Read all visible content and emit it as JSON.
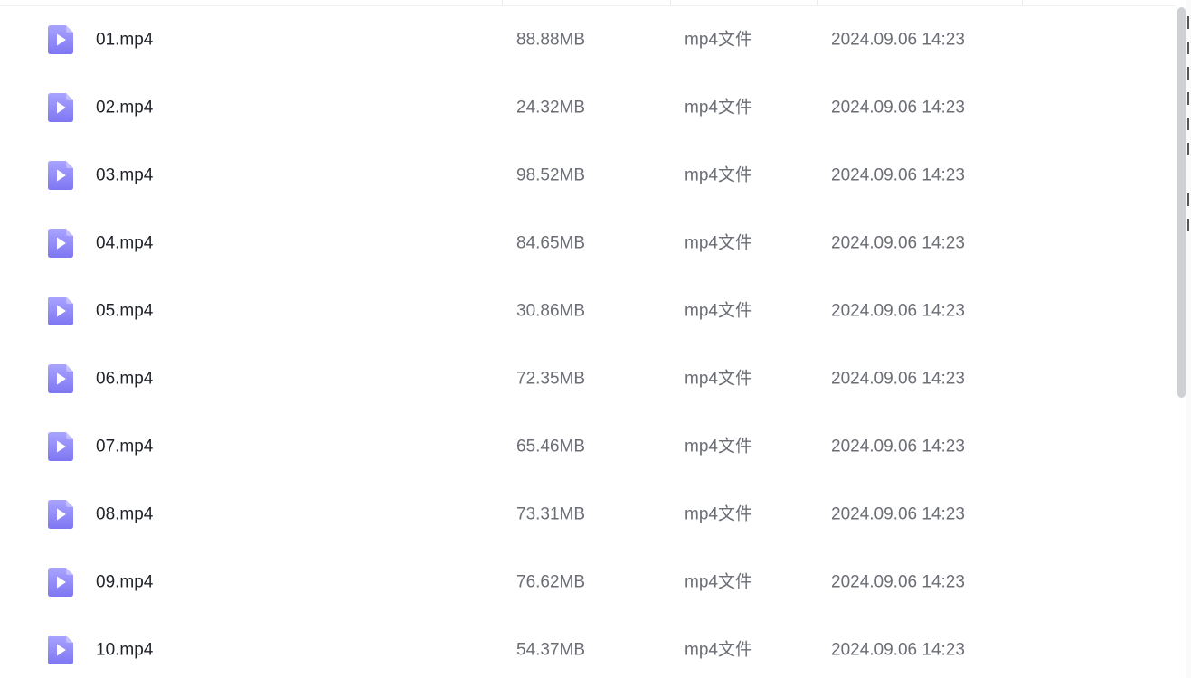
{
  "file_list": {
    "rows": [
      {
        "name": "01.mp4",
        "size": "88.88MB",
        "type": "mp4文件",
        "modified": "2024.09.06 14:23",
        "icon": "video-file-icon"
      },
      {
        "name": "02.mp4",
        "size": "24.32MB",
        "type": "mp4文件",
        "modified": "2024.09.06 14:23",
        "icon": "video-file-icon"
      },
      {
        "name": "03.mp4",
        "size": "98.52MB",
        "type": "mp4文件",
        "modified": "2024.09.06 14:23",
        "icon": "video-file-icon"
      },
      {
        "name": "04.mp4",
        "size": "84.65MB",
        "type": "mp4文件",
        "modified": "2024.09.06 14:23",
        "icon": "video-file-icon"
      },
      {
        "name": "05.mp4",
        "size": "30.86MB",
        "type": "mp4文件",
        "modified": "2024.09.06 14:23",
        "icon": "video-file-icon"
      },
      {
        "name": "06.mp4",
        "size": "72.35MB",
        "type": "mp4文件",
        "modified": "2024.09.06 14:23",
        "icon": "video-file-icon"
      },
      {
        "name": "07.mp4",
        "size": "65.46MB",
        "type": "mp4文件",
        "modified": "2024.09.06 14:23",
        "icon": "video-file-icon"
      },
      {
        "name": "08.mp4",
        "size": "73.31MB",
        "type": "mp4文件",
        "modified": "2024.09.06 14:23",
        "icon": "video-file-icon"
      },
      {
        "name": "09.mp4",
        "size": "76.62MB",
        "type": "mp4文件",
        "modified": "2024.09.06 14:23",
        "icon": "video-file-icon"
      },
      {
        "name": "10.mp4",
        "size": "54.37MB",
        "type": "mp4文件",
        "modified": "2024.09.06 14:23",
        "icon": "video-file-icon"
      }
    ]
  },
  "colors": {
    "icon_gradient_top": "#a9a4ff",
    "icon_gradient_bottom": "#7e76f2",
    "name_text": "#1f2329",
    "meta_text": "#6b6e75",
    "scrollbar": "#cfd0d3"
  }
}
